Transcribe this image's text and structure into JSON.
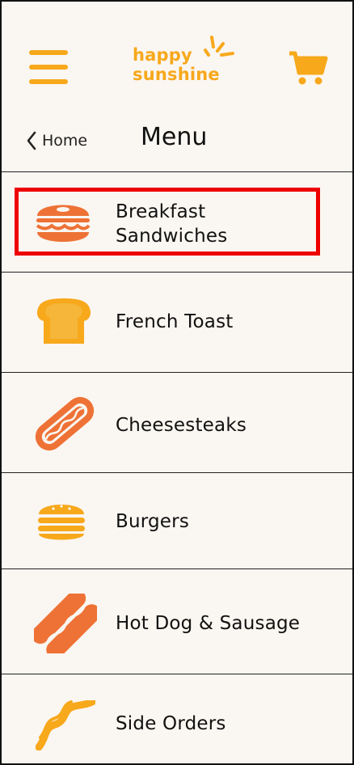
{
  "header": {
    "logo_line1": "happy",
    "logo_line2": "sunshine"
  },
  "navbar": {
    "back_label": "Home",
    "title": "Menu"
  },
  "menu": [
    {
      "label": "Breakfast Sandwiches",
      "icon": "bagel-sandwich-icon"
    },
    {
      "label": "French Toast",
      "icon": "toast-icon"
    },
    {
      "label": "Cheesesteaks",
      "icon": "hoagie-icon"
    },
    {
      "label": "Burgers",
      "icon": "burger-icon"
    },
    {
      "label": "Hot Dog & Sausage",
      "icon": "hot-dog-icon"
    },
    {
      "label": "Side Orders",
      "icon": "bacon-icon"
    }
  ],
  "colors": {
    "background": "#faf6f1",
    "brand_yellow": "#f7a81b",
    "accent_orange": "#ee7236",
    "highlight": "#ee0000"
  }
}
